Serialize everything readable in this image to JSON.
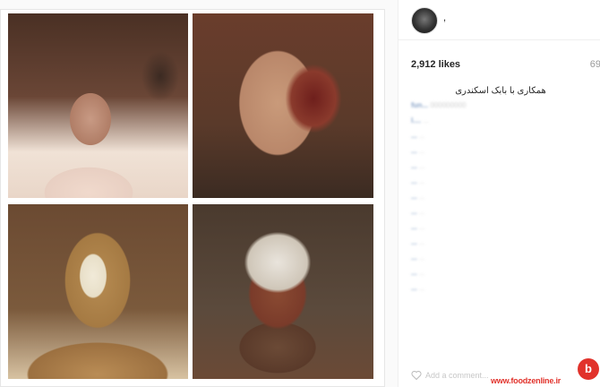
{
  "post": {
    "username": ",",
    "likes": "2,912 likes",
    "date": "69",
    "caption": "همکاری با بابک اسکندری"
  },
  "comments": [
    {
      "user": "fun...",
      "text": "000000000"
    },
    {
      "user": "l....",
      "text": "..."
    },
    {
      "user": "...",
      "text": "..."
    },
    {
      "user": "...",
      "text": "..."
    },
    {
      "user": "...",
      "text": "..."
    },
    {
      "user": "...",
      "text": "..."
    },
    {
      "user": "...",
      "text": "..."
    },
    {
      "user": "...",
      "text": "..."
    },
    {
      "user": "...",
      "text": "..."
    },
    {
      "user": "...",
      "text": "..."
    },
    {
      "user": "...",
      "text": "..."
    },
    {
      "user": "...",
      "text": "..."
    },
    {
      "user": "...",
      "text": "..."
    }
  ],
  "add_comment_placeholder": "Add a comment...",
  "watermark": "www.foodzenline.ir",
  "watermark_symbol": "b",
  "icons": {
    "avatar": "profile-avatar",
    "heart": "heart-icon"
  },
  "colors": {
    "accent": "#e1322b",
    "link": "#8aa4c8"
  }
}
